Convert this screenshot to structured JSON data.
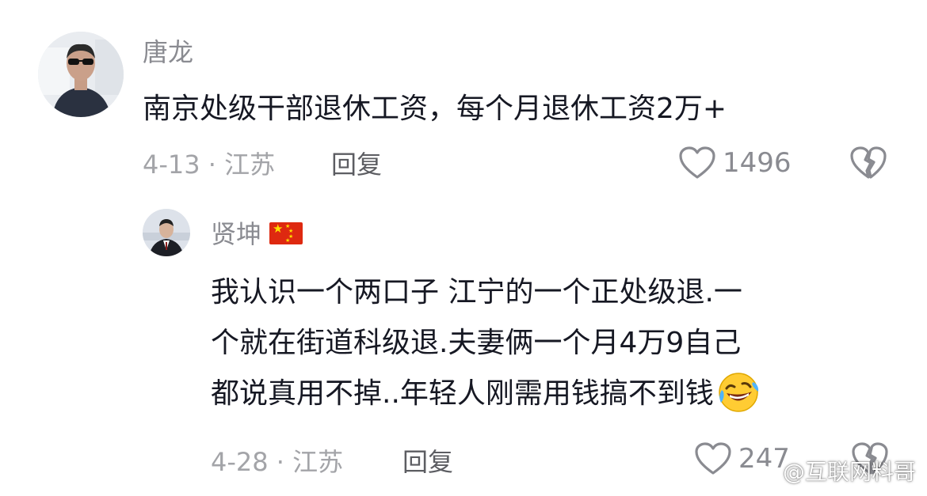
{
  "comments": [
    {
      "username": "唐龙",
      "text": "南京处级干部退休工资，每个月退休工资2万+",
      "date_location": "4-13 · 江苏",
      "reply_label": "回复",
      "like_count": "1496",
      "avatar": "avatar-man-sunglasses"
    },
    {
      "username": "贤坤",
      "flag": "flag-cn-icon",
      "text_lines": [
        "我认识一个两口子 江宁的一个正处级退.一",
        "个就在街道科级退.夫妻俩一个月4万9自己",
        "都说真用不掉..年轻人刚需用钱搞不到钱"
      ],
      "emoji": "rolling-laughing-emoji",
      "date_location": "4-28 · 江苏",
      "reply_label": "回复",
      "like_count": "247",
      "avatar": "avatar-man-suit"
    }
  ],
  "watermark": {
    "text": "@互联网料哥",
    "icon": "weibo-icon"
  },
  "colors": {
    "primary_text": "#161823",
    "secondary_text": "#8a8b91",
    "meta_text": "#a3a4a8",
    "reply_text": "#5c5d62",
    "flag_red": "#de2910"
  }
}
